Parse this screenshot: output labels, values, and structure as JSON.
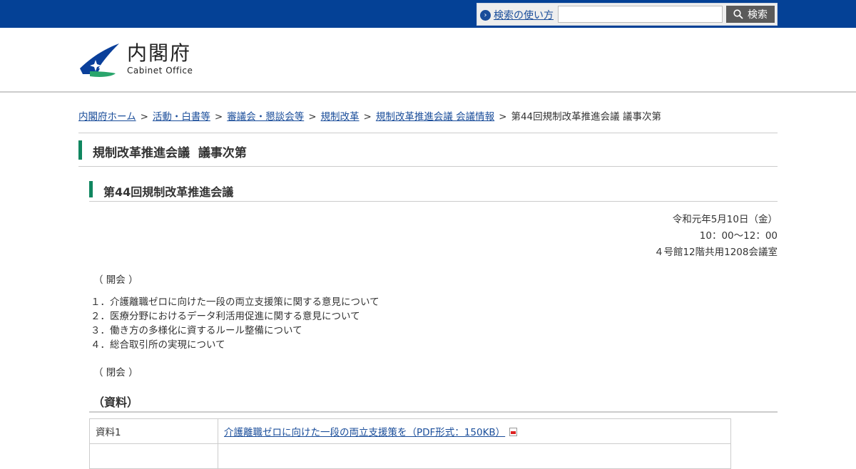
{
  "topbar": {
    "help_link": "検索の使い方",
    "search_placeholder": "",
    "search_button": "検索"
  },
  "logo": {
    "name_jp": "内閣府",
    "name_en": "Cabinet Office"
  },
  "breadcrumb": {
    "items": [
      "内閣府ホーム",
      "活動・白書等",
      "審議会・懇談会等",
      "規制改革",
      "規制改革推進会議 会議情報"
    ],
    "current": "第44回規制改革推進会議 議事次第",
    "separator": ">"
  },
  "page_title": "規制改革推進会議  議事次第",
  "meeting": {
    "title": "第44回規制改革推進会議",
    "date": "令和元年5月10日（金）",
    "time": "10：00～12：00",
    "place": "４号館12階共用1208会議室"
  },
  "agenda": {
    "open": "（ 開会 ）",
    "items": [
      "１．介護離職ゼロに向けた一段の両立支援策に関する意見について",
      "２．医療分野におけるデータ利活用促進に関する意見について",
      "３．働き方の多様化に資するルール整備について",
      "４．総合取引所の実現について"
    ],
    "close": "（ 閉会 ）"
  },
  "materials": {
    "heading": "（資料）",
    "rows": [
      {
        "label": "資料1",
        "link": "介護離職ゼロに向けた一段の両立支援策を（PDF形式：150KB）"
      },
      {
        "label": "",
        "link": ""
      }
    ]
  },
  "colors": {
    "topbar": "#044196",
    "accent_bar": "#108660",
    "link": "#1a4d9a"
  }
}
